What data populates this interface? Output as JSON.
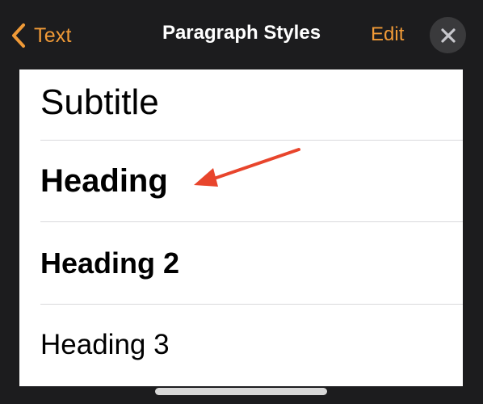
{
  "header": {
    "back_label": "Text",
    "title": "Paragraph Styles",
    "edit_label": "Edit"
  },
  "styles": [
    {
      "label": "Subtitle"
    },
    {
      "label": "Heading"
    },
    {
      "label": "Heading 2"
    },
    {
      "label": "Heading 3"
    }
  ],
  "colors": {
    "accent": "#f09a37",
    "annotation_arrow": "#e8452c",
    "background": "#1c1c1e",
    "list_background": "#ffffff"
  },
  "icons": {
    "back": "chevron-left-icon",
    "close": "close-icon",
    "annotation": "arrow-annotation-icon"
  }
}
